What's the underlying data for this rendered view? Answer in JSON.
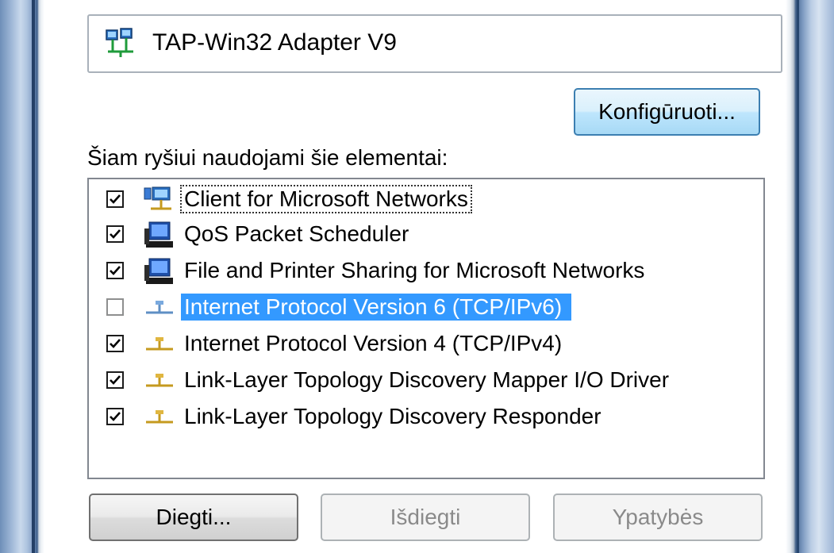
{
  "adapter": {
    "name": "TAP-Win32 Adapter V9",
    "icon": "network-adapter-icon"
  },
  "configure_label": "Konfigūruoti...",
  "components_label": "Šiam ryšiui naudojami šie elementai:",
  "components": [
    {
      "label": "Client for Microsoft Networks",
      "checked": true,
      "icon": "client-network-icon",
      "focused": true,
      "selected": false
    },
    {
      "label": "QoS Packet Scheduler",
      "checked": true,
      "icon": "computer-service-icon",
      "focused": false,
      "selected": false
    },
    {
      "label": "File and Printer Sharing for Microsoft Networks",
      "checked": true,
      "icon": "computer-service-icon",
      "focused": false,
      "selected": false
    },
    {
      "label": "Internet Protocol Version 6 (TCP/IPv6)",
      "checked": false,
      "icon": "protocol-icon",
      "focused": false,
      "selected": true
    },
    {
      "label": "Internet Protocol Version 4 (TCP/IPv4)",
      "checked": true,
      "icon": "protocol-icon",
      "focused": false,
      "selected": false
    },
    {
      "label": "Link-Layer Topology Discovery Mapper I/O Driver",
      "checked": true,
      "icon": "protocol-icon",
      "focused": false,
      "selected": false
    },
    {
      "label": "Link-Layer Topology Discovery Responder",
      "checked": true,
      "icon": "protocol-icon",
      "focused": false,
      "selected": false
    }
  ],
  "buttons": {
    "install": "Diegti...",
    "uninstall": "Išdiegti",
    "properties": "Ypatybės"
  },
  "colors": {
    "selection": "#3399ff",
    "frame": "#3b5a84"
  }
}
